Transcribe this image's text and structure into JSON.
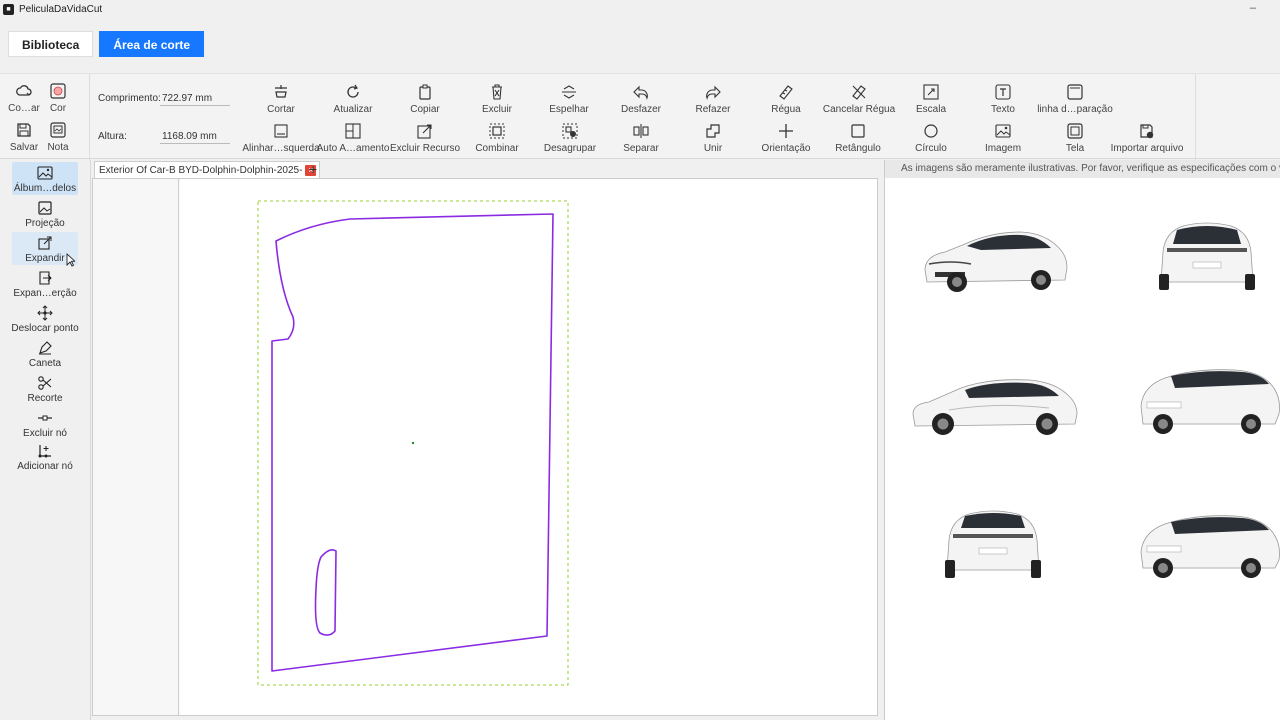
{
  "window": {
    "title": "PeliculaDaVidaCut",
    "minimize": "–"
  },
  "modes": [
    {
      "label": "Biblioteca",
      "active": false
    },
    {
      "label": "Área de corte",
      "active": true
    }
  ],
  "file_tools": {
    "open_label": "Co…ar",
    "color_label": "Cor",
    "save_label": "Salvar",
    "note_label": "Nota"
  },
  "dimensions": {
    "length_label": "Comprimento:",
    "length_value": "722.97 mm",
    "height_label": "Altura:",
    "height_value": "1168.09 mm"
  },
  "toolbar": {
    "row1": [
      "Cortar",
      "Atualizar",
      "Copiar",
      "Excluir",
      "Espelhar",
      "Desfazer",
      "Refazer",
      "Régua",
      "Cancelar Régua",
      "Escala",
      "Texto",
      "linha d…paração"
    ],
    "row2": [
      "Alinhar…squerda",
      "Auto A…amento",
      "Excluir Recurso",
      "Combinar",
      "Desagrupar",
      "Separar",
      "Unir",
      "Orientação",
      "Retângulo",
      "Círculo",
      "Imagem",
      "Tela",
      "Importar arquivo"
    ]
  },
  "sidebar": {
    "items": [
      {
        "label": "Álbum…delos",
        "icon": "album-icon"
      },
      {
        "label": "Projeção",
        "icon": "projection-icon"
      },
      {
        "label": "Expandir",
        "icon": "expand-icon"
      },
      {
        "label": "Expan…erção",
        "icon": "expand-insert-icon"
      },
      {
        "label": "Deslocar ponto",
        "icon": "move-point-icon"
      },
      {
        "label": "Caneta",
        "icon": "pen-icon"
      },
      {
        "label": "Recorte",
        "icon": "scissors-icon"
      },
      {
        "label": "Excluir nó",
        "icon": "delete-node-icon"
      },
      {
        "label": "Adicionar nó",
        "icon": "add-node-icon"
      }
    ]
  },
  "document": {
    "tab_title": "Exterior Of Car-B BYD-Dolphin-Dolphin-2025-",
    "close": "×",
    "add": "+"
  },
  "right_panel": {
    "notice": "As imagens são meramente ilustrativas. Por favor, verifique as especificações com o veículo em"
  },
  "colors": {
    "accent": "#1677ff",
    "cut_path": "#8a2be2",
    "boundary": "#9acd32",
    "selected": "#cfe3f7"
  }
}
